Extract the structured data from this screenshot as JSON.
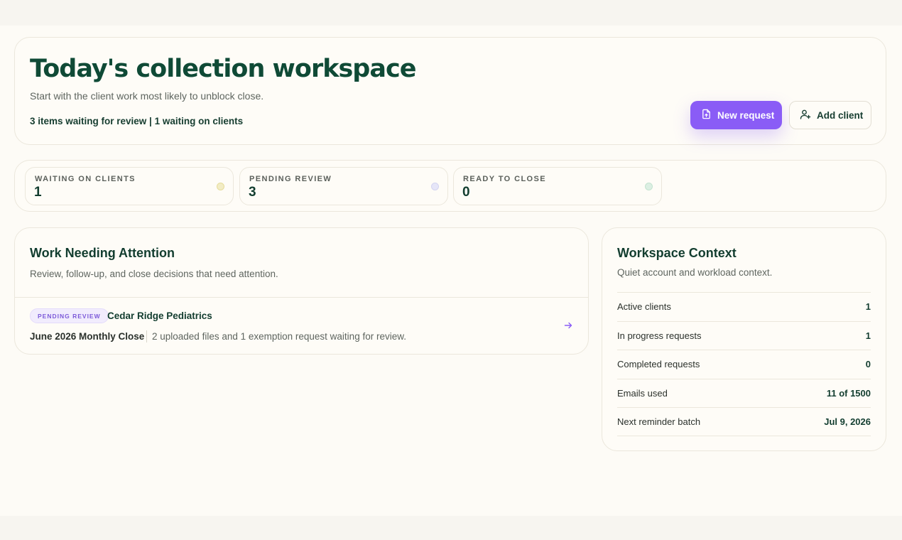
{
  "hero": {
    "title": "Today's collection workspace",
    "subtitle": "Start with the client work most likely to unblock close.",
    "summary": "3 items waiting for review | 1 waiting on clients",
    "new_request_label": "New request",
    "add_client_label": "Add client"
  },
  "stats": [
    {
      "label": "WAITING ON CLIENTS",
      "value": "1",
      "dot_color": "#f2ecc4"
    },
    {
      "label": "PENDING REVIEW",
      "value": "3",
      "dot_color": "#e6e6f8"
    },
    {
      "label": "READY TO CLOSE",
      "value": "0",
      "dot_color": "#dcefe3"
    }
  ],
  "attention": {
    "title": "Work Needing Attention",
    "subtitle": "Review, follow-up, and close decisions that need attention.",
    "items": [
      {
        "badge": "PENDING REVIEW",
        "client": "Cedar Ridge Pediatrics",
        "period": "June 2026 Monthly Close",
        "description": "2 uploaded files and 1 exemption request waiting for review."
      }
    ]
  },
  "context": {
    "title": "Workspace Context",
    "subtitle": "Quiet account and workload context.",
    "rows": [
      {
        "label": "Active clients",
        "value": "1"
      },
      {
        "label": "In progress requests",
        "value": "1"
      },
      {
        "label": "Completed requests",
        "value": "0"
      },
      {
        "label": "Emails used",
        "value": "11 of 1500"
      },
      {
        "label": "Next reminder batch",
        "value": "Jul 9, 2026"
      }
    ]
  },
  "colors": {
    "brand_green": "#0f4a36",
    "accent_purple": "#8a5cf6"
  },
  "icons": {
    "new_request": "file-upload-icon",
    "add_client": "user-plus-icon",
    "row_open": "arrow-right-icon"
  }
}
